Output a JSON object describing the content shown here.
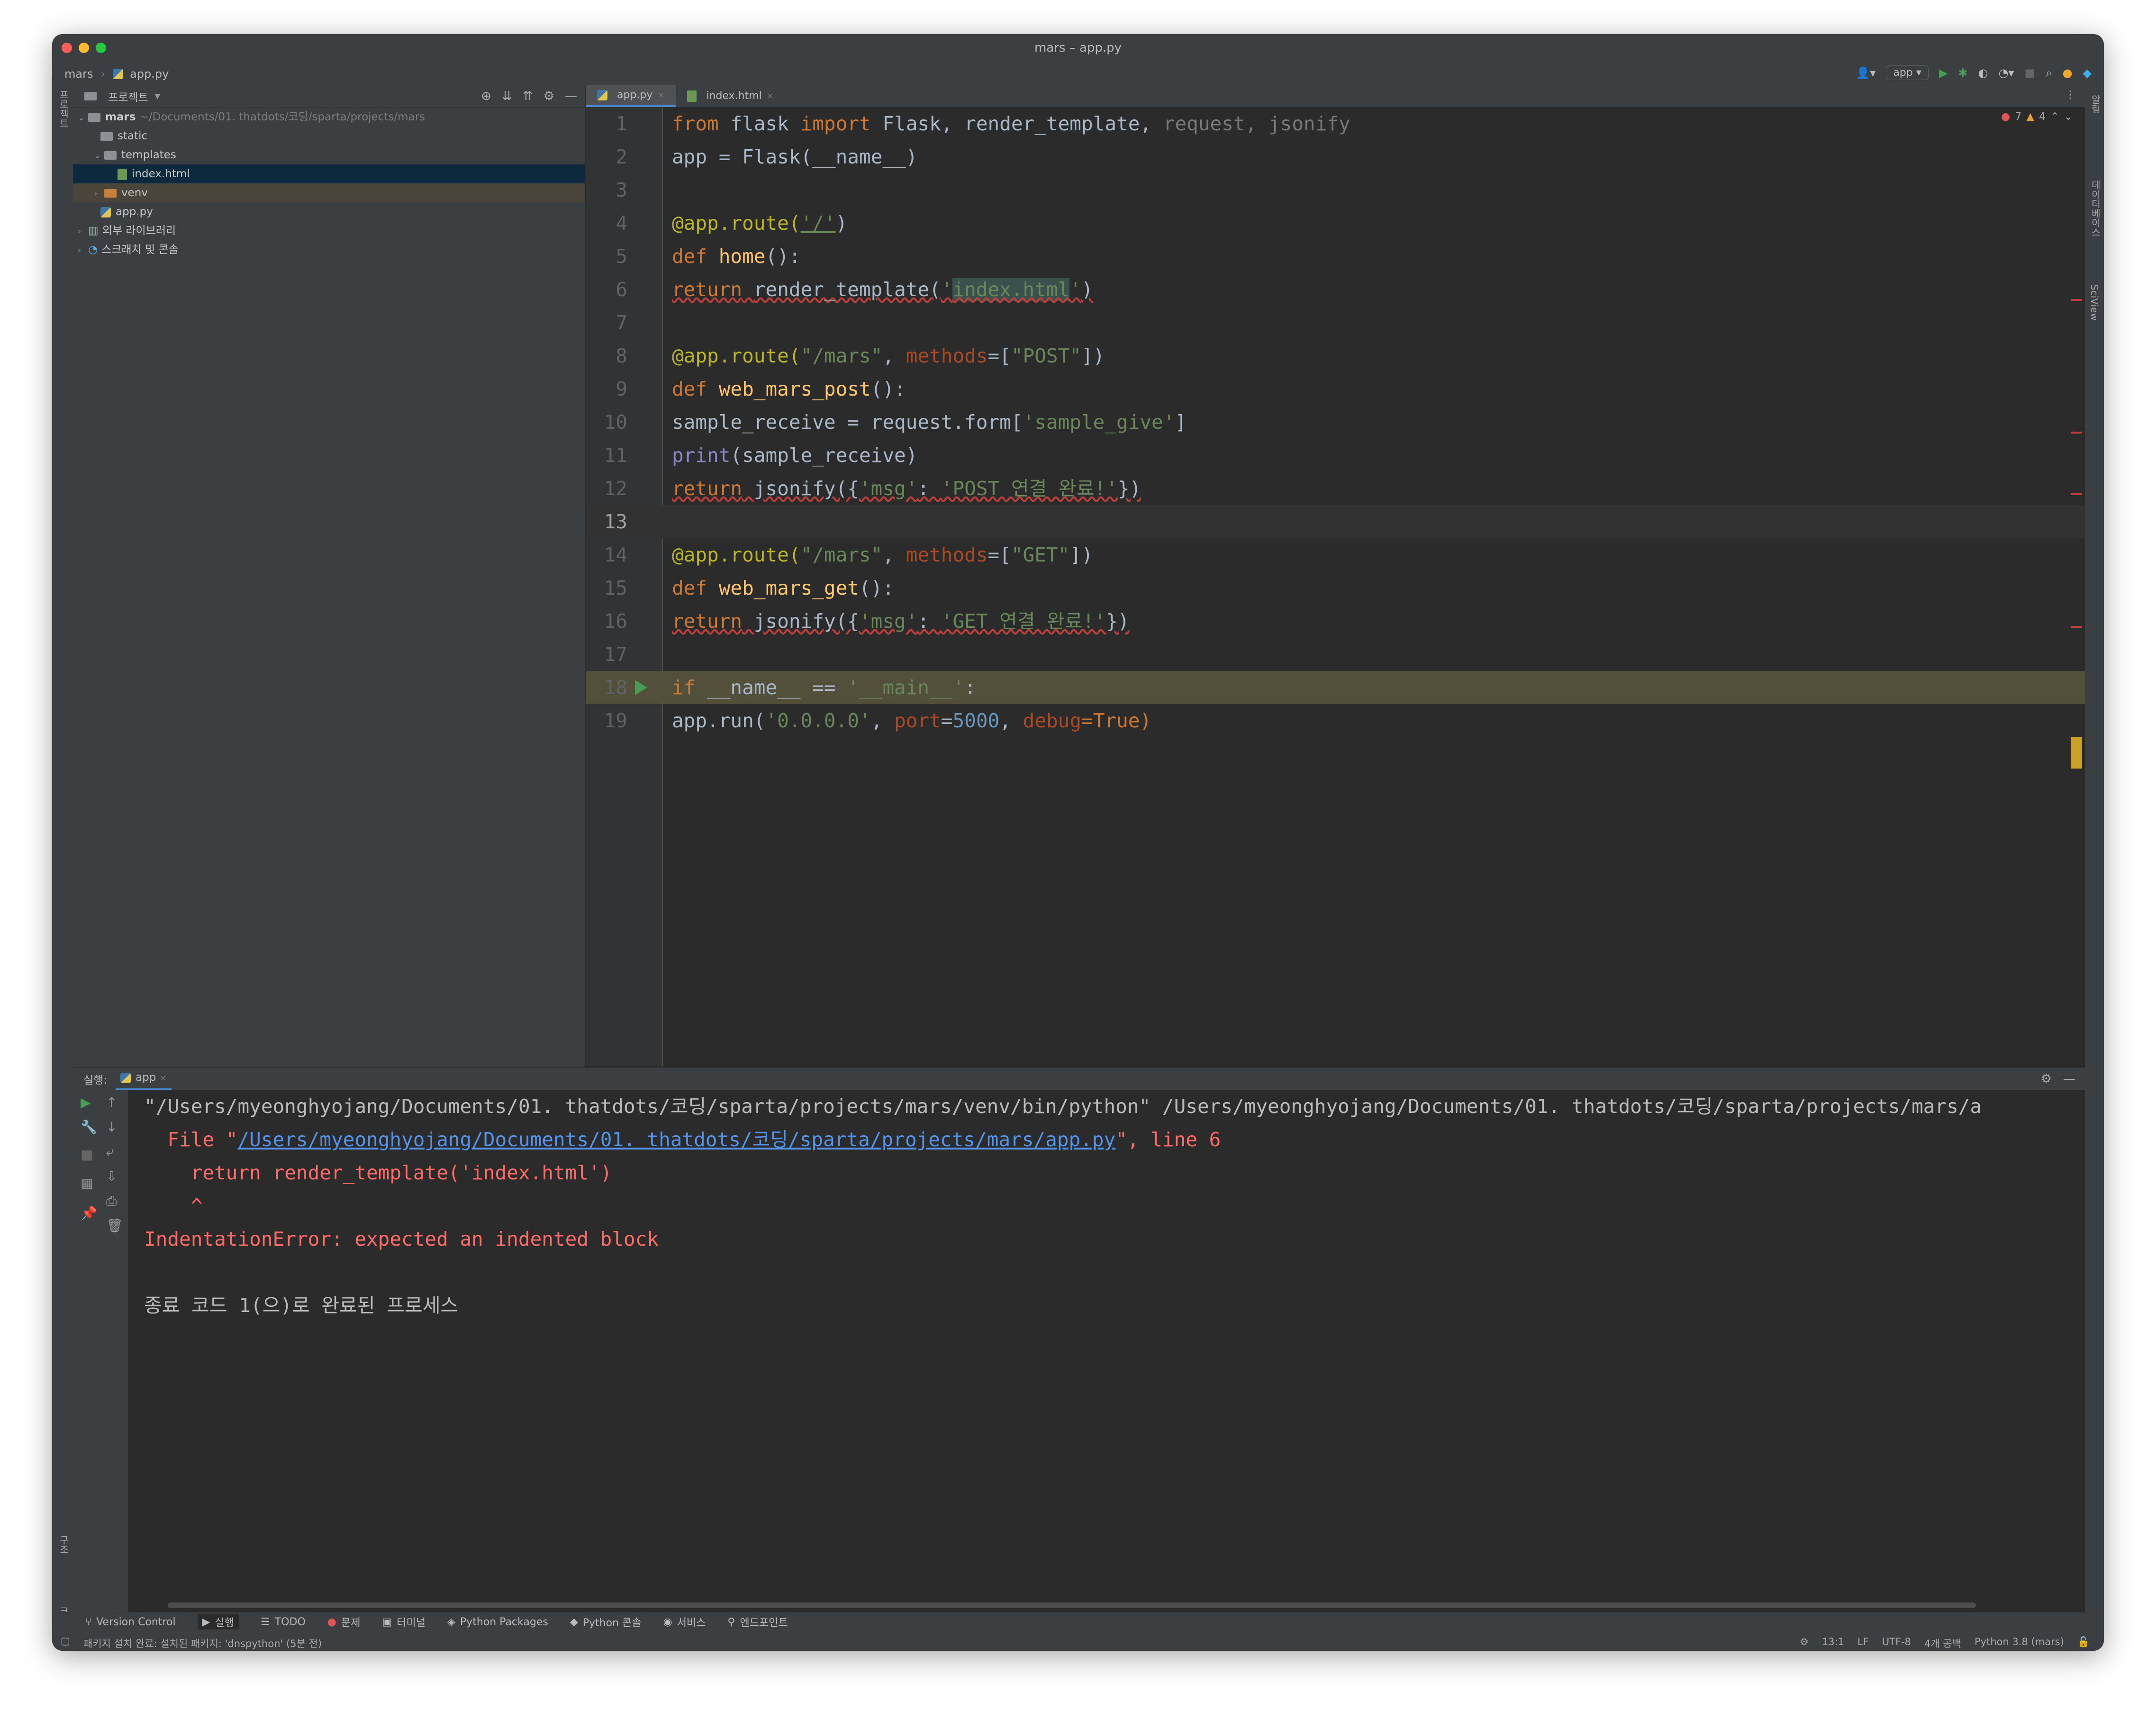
{
  "window": {
    "title": "mars – app.py"
  },
  "breadcrumb": {
    "project": "mars",
    "file": "app.py"
  },
  "toolbar": {
    "run_config": "app"
  },
  "left_strip": {
    "project_label": "프로젝트",
    "structure_label": "구조",
    "bookmarks_label": "북마크"
  },
  "right_strip": {
    "notifications_label": "알림",
    "database_label": "데이터베이스",
    "sciview_label": "SciView"
  },
  "project_panel": {
    "title": "프로젝트",
    "tree": [
      {
        "name": "mars",
        "path": "~/Documents/01. thatdots/코딩/sparta/projects/mars"
      },
      {
        "name": "static"
      },
      {
        "name": "templates"
      },
      {
        "name": "index.html"
      },
      {
        "name": "venv"
      },
      {
        "name": "app.py"
      },
      {
        "name": "외부 라이브러리"
      },
      {
        "name": "스크래치 및 콘솔"
      }
    ]
  },
  "editor": {
    "tabs": [
      {
        "label": "app.py"
      },
      {
        "label": "index.html"
      }
    ],
    "inspections": {
      "errors": "7",
      "warnings": "4"
    },
    "line_numbers": [
      "1",
      "2",
      "3",
      "4",
      "5",
      "6",
      "7",
      "8",
      "9",
      "10",
      "11",
      "12",
      "13",
      "14",
      "15",
      "16",
      "17",
      "18",
      "19"
    ],
    "code": {
      "l1": [
        "from",
        "flask",
        "import",
        "Flask,",
        "render_template,",
        "request,",
        "jsonify"
      ],
      "l2": "app = Flask(__name__)",
      "l4": [
        "@app.route(",
        "'/'",
        ")"
      ],
      "l5": [
        "def",
        "home",
        "():"
      ],
      "l6": [
        "return",
        "render_template(",
        "'",
        "index.html",
        "'",
        ")"
      ],
      "l8": [
        "@app.route(",
        "\"/mars\"",
        ", ",
        "methods",
        "=[",
        "\"POST\"",
        "])"
      ],
      "l9": [
        "def",
        "web_mars_post",
        "():"
      ],
      "l10": [
        "sample_receive = request.form[",
        "'sample_give'",
        "]"
      ],
      "l11": [
        "print",
        "(sample_receive)"
      ],
      "l12": [
        "return",
        "jsonify({",
        "'msg'",
        ": ",
        "'POST 연결 완료!'",
        "})"
      ],
      "l14": [
        "@app.route(",
        "\"/mars\"",
        ", ",
        "methods",
        "=[",
        "\"GET\"",
        "])"
      ],
      "l15": [
        "def",
        "web_mars_get",
        "():"
      ],
      "l16": [
        "return",
        "jsonify({",
        "'msg'",
        ": ",
        "'GET 연결 완료!'",
        "})"
      ],
      "l18": [
        "if",
        "__name__ == ",
        "'__main__'",
        ":"
      ],
      "l19": [
        "app.run(",
        "'0.0.0.0'",
        ", ",
        "port",
        "=",
        "5000",
        ", ",
        "debug",
        "=True)"
      ]
    }
  },
  "run_panel": {
    "label": "실행:",
    "tab": "app",
    "output": {
      "cmd": "\"/Users/myeonghyojang/Documents/01. thatdots/코딩/sparta/projects/mars/venv/bin/python\" /Users/myeonghyojang/Documents/01. thatdots/코딩/sparta/projects/mars/a",
      "file_prefix": "  File \"",
      "file_link": "/Users/myeonghyojang/Documents/01. thatdots/코딩/sparta/projects/mars/app.py",
      "file_suffix": "\", line 6",
      "source_line": "    return render_template('index.html')",
      "caret": "    ^",
      "error": "IndentationError: expected an indented block",
      "exit": "종료 코드 1(으)로 완료된 프로세스"
    }
  },
  "bottom_tools": [
    "Version Control",
    "실행",
    "TODO",
    "문제",
    "터미널",
    "Python Packages",
    "Python 콘솔",
    "서비스",
    "엔드포인트"
  ],
  "status": {
    "message": "패키지 설치 완료: 설치된 패키지: 'dnspython' (5분 전)",
    "position": "13:1",
    "line_sep": "LF",
    "encoding": "UTF-8",
    "indent": "4개 공백",
    "interpreter": "Python 3.8 (mars)"
  },
  "colors": {
    "keyword": "#cc7832",
    "string": "#6a8759",
    "decorator": "#bbb529",
    "error": "#ff6b68",
    "link": "#5394ec",
    "accent": "#4a88c7"
  }
}
